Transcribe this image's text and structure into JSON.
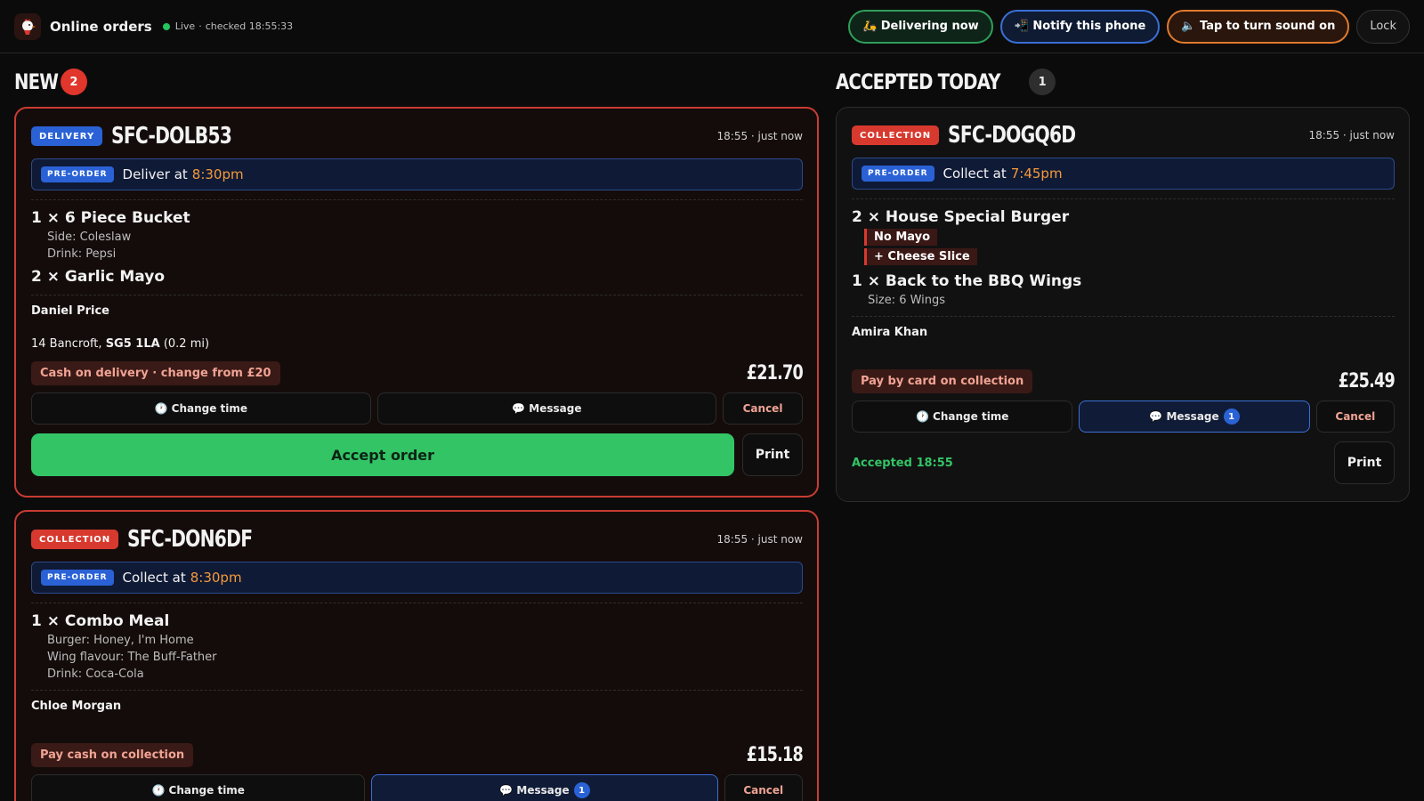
{
  "header": {
    "logo_icon": "chicken-logo-icon",
    "title": "Online orders",
    "live_label": "Live",
    "checked_label": "checked 18:55:33",
    "buttons": {
      "delivering": "🛵 Delivering now",
      "notify": "📲 Notify this phone",
      "sound": "🔈 Tap to turn sound on",
      "lock": "Lock"
    }
  },
  "colors": {
    "accent_red": "#d8392e",
    "accent_blue": "#2a62d6",
    "accent_green": "#33c466",
    "accent_orange": "#f59a3a"
  },
  "new_column": {
    "title": "NEW",
    "count": "2",
    "orders": [
      {
        "type": "DELIVERY",
        "id": "SFC-DOLB53",
        "time": "18:55 · just now",
        "preorder_badge": "PRE-ORDER",
        "preorder_text": "Deliver at",
        "preorder_time": "8:30pm",
        "items": [
          {
            "title": "1 × 6 Piece Bucket",
            "options": [
              "Side: Coleslaw",
              "Drink: Pepsi"
            ]
          },
          {
            "title": "2 × Garlic Mayo",
            "options": []
          }
        ],
        "customer": "Daniel Price",
        "address_street": "14 Bancroft,",
        "address_postcode": "SG5 1LA",
        "address_distance": "(0.2 mi)",
        "payment": "Cash on delivery · change from £20",
        "total": "£21.70",
        "btn_change_time": "🕐 Change time",
        "btn_message": "💬 Message",
        "btn_cancel": "Cancel",
        "btn_accept": "Accept order",
        "btn_print": "Print"
      },
      {
        "type": "COLLECTION",
        "id": "SFC-DON6DF",
        "time": "18:55 · just now",
        "preorder_badge": "PRE-ORDER",
        "preorder_text": "Collect at",
        "preorder_time": "8:30pm",
        "items": [
          {
            "title": "1 × Combo Meal",
            "options": [
              "Burger: Honey, I'm Home",
              "Wing flavour: The Buff-Father",
              "Drink: Coca-Cola"
            ]
          }
        ],
        "customer": "Chloe Morgan",
        "payment": "Pay cash on collection",
        "total": "£15.18",
        "btn_change_time": "🕐 Change time",
        "btn_message": "💬 Message",
        "message_count": "1",
        "btn_cancel": "Cancel"
      }
    ]
  },
  "accepted_column": {
    "title": "ACCEPTED TODAY",
    "count": "1",
    "orders": [
      {
        "type": "COLLECTION",
        "id": "SFC-DOGQ6D",
        "time": "18:55 · just now",
        "preorder_badge": "PRE-ORDER",
        "preorder_text": "Collect at",
        "preorder_time": "7:45pm",
        "items": [
          {
            "title": "2 × House Special Burger",
            "modifiers": [
              "No Mayo",
              "+ Cheese Slice"
            ]
          },
          {
            "title": "1 × Back to the BBQ Wings",
            "options": [
              "Size: 6 Wings"
            ]
          }
        ],
        "customer": "Amira Khan",
        "payment": "Pay by card on collection",
        "total": "£25.49",
        "btn_change_time": "🕐 Change time",
        "btn_message": "💬 Message",
        "message_count": "1",
        "btn_cancel": "Cancel",
        "accepted_label": "Accepted 18:55",
        "btn_print": "Print"
      }
    ]
  }
}
